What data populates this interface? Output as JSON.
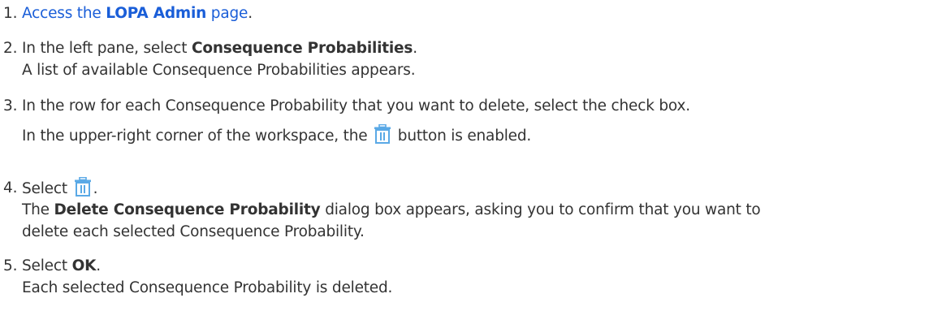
{
  "steps": [
    {
      "number": "1.",
      "link_prefix": "Access the ",
      "link_bold": "LOPA Admin",
      "link_suffix": " page",
      "end": "."
    },
    {
      "number": "2.",
      "text_prefix": "In the left pane, select ",
      "text_bold": "Consequence Probabilities",
      "text_suffix": ".",
      "result": "A list of available Consequence Probabilities appears."
    },
    {
      "number": "3.",
      "text": "In the row for each Consequence Probability that you want to delete, select the check box.",
      "result_prefix": "In the upper-right corner of the workspace, the ",
      "result_icon": "trash-icon",
      "result_suffix": " button is enabled."
    },
    {
      "number": "4.",
      "text_prefix": "Select ",
      "text_icon": "trash-icon",
      "text_suffix": ".",
      "result_bold": "Delete Consequence Probability",
      "result_suffix": " dialog box appears, asking you to confirm that you want to",
      "result_prefix": "The ",
      "result_line2": "delete each selected Consequence Probability."
    },
    {
      "number": "5.",
      "text_prefix": "Select ",
      "text_bold": "OK",
      "text_suffix": ".",
      "result": "Each selected Consequence Probability is deleted."
    }
  ],
  "colors": {
    "link": "#1a5ed8",
    "text": "#333333",
    "icon": "#5aa9e6"
  }
}
